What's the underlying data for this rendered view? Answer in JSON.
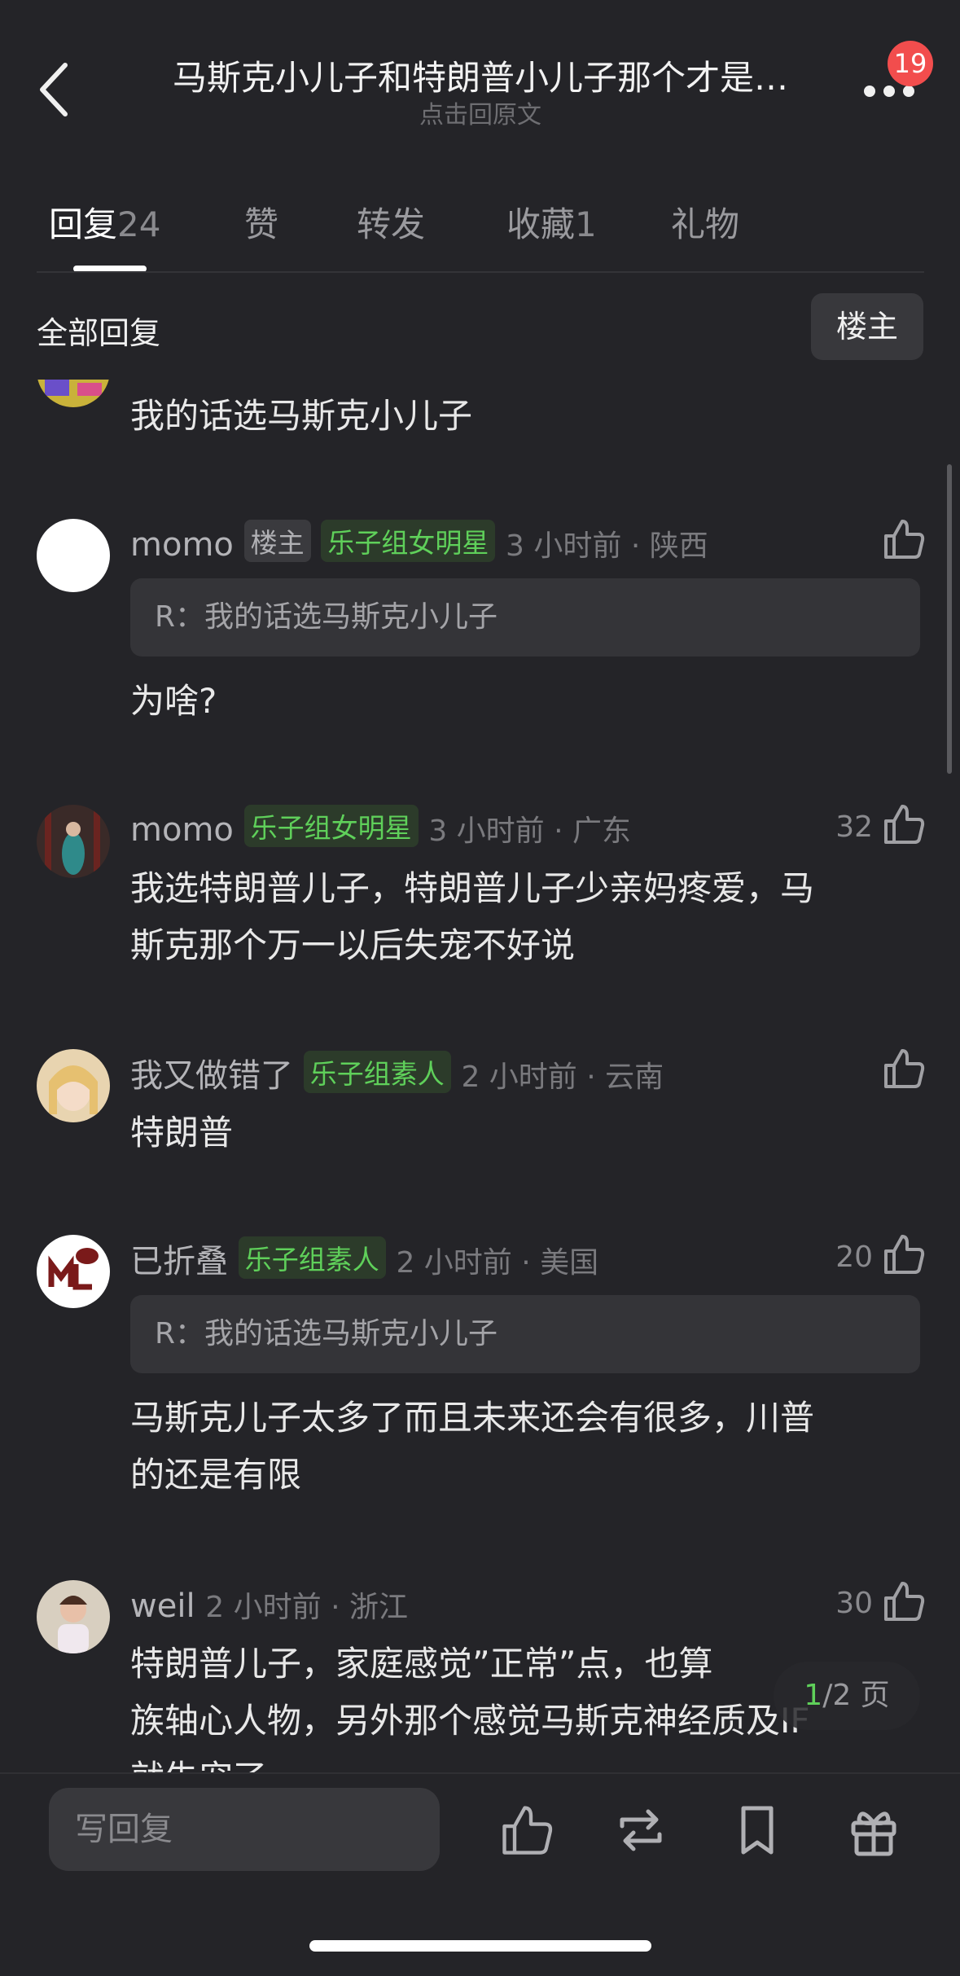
{
  "header": {
    "title": "马斯克小儿子和特朗普小儿子那个才是…",
    "subtitle": "点击回原文",
    "notification_count": "19"
  },
  "tabs": [
    {
      "label": "回复",
      "count": "24",
      "active": true
    },
    {
      "label": "赞",
      "count": ""
    },
    {
      "label": "转发",
      "count": ""
    },
    {
      "label": "收藏",
      "count": "1"
    },
    {
      "label": "礼物",
      "count": ""
    }
  ],
  "filter": {
    "label": "全部回复",
    "op_button": "楼主"
  },
  "comments": [
    {
      "text": "我的话选马斯克小儿子"
    },
    {
      "name": "momo",
      "op_tag": "楼主",
      "tag": "乐子组女明星",
      "meta": "3 小时前 · 陕西",
      "quote": "R：我的话选马斯克小儿子",
      "text": "为啥?",
      "likes": ""
    },
    {
      "name": "momo",
      "tag": "乐子组女明星",
      "meta": "3 小时前 · 广东",
      "text_line1": "我选特朗普儿子，特朗普儿子少亲妈疼爱，马",
      "text_line2": "斯克那个万一以后失宠不好说",
      "likes": "32"
    },
    {
      "name": "我又做错了",
      "tag": "乐子组素人",
      "meta": "2 小时前 · 云南",
      "text": "特朗普",
      "likes": ""
    },
    {
      "name": "已折叠",
      "tag": "乐子组素人",
      "meta": "2 小时前 · 美国",
      "quote": "R：我的话选马斯克小儿子",
      "text_line1": "马斯克儿子太多了而且未来还会有很多，川普",
      "text_line2": "的还是有限",
      "likes": "20"
    },
    {
      "name": "weil",
      "meta": "2 小时前 · 浙江",
      "text_line1": "特朗普儿子，家庭感觉”正常”点，也算",
      "text_line2": "族轴心人物，另外那个感觉马斯克神经质及IF",
      "text_line3": "就失宠了",
      "likes": "30"
    }
  ],
  "pager": {
    "current": "1",
    "total": "/2 页"
  },
  "bottom": {
    "reply_placeholder": "写回复"
  },
  "colors": {
    "background": "#242428",
    "accent_green": "#5fd05a",
    "badge_red": "#f24d4d"
  }
}
